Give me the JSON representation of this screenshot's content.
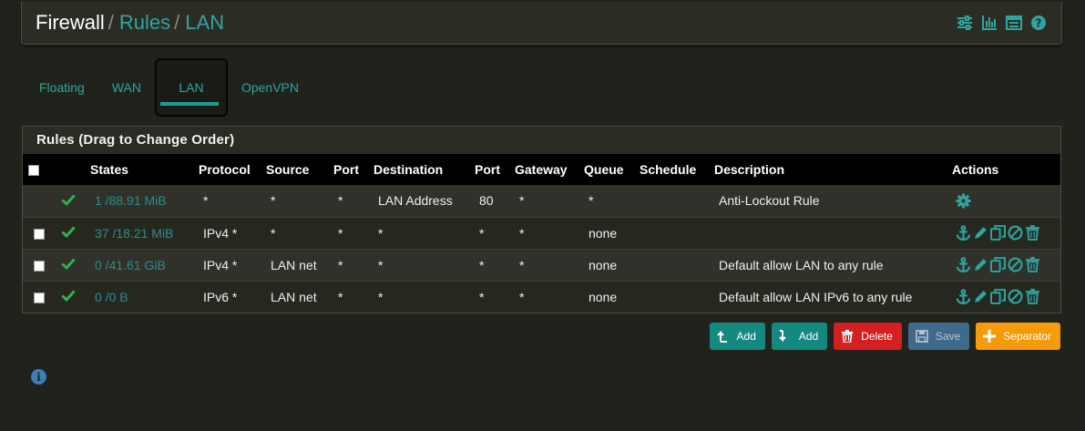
{
  "breadcrumb": {
    "root": "Firewall",
    "sep1": "/",
    "level2": "Rules",
    "sep2": "/",
    "level3": "LAN"
  },
  "header_icons": [
    "sliders-icon",
    "bar-chart-icon",
    "list-icon",
    "help-icon"
  ],
  "tabs": [
    {
      "label": "Floating",
      "active": false
    },
    {
      "label": "WAN",
      "active": false
    },
    {
      "label": "LAN",
      "active": true
    },
    {
      "label": "OpenVPN",
      "active": false
    }
  ],
  "panel": {
    "title": "Rules (Drag to Change Order)",
    "columns": [
      "",
      "",
      "States",
      "Protocol",
      "Source",
      "Port",
      "Destination",
      "Port",
      "Gateway",
      "Queue",
      "Schedule",
      "Description",
      "Actions"
    ],
    "rows": [
      {
        "checkbox": false,
        "states": "1 /88.91 MiB",
        "protocol": "*",
        "source": "*",
        "port": "*",
        "destination": "LAN Address",
        "dport": "80",
        "gateway": "*",
        "queue": "*",
        "schedule": "",
        "description": "Anti-Lockout Rule",
        "actions": [
          "gear-icon"
        ]
      },
      {
        "checkbox": true,
        "states": "37 /18.21 MiB",
        "protocol": "IPv4 *",
        "source": "*",
        "port": "*",
        "destination": "*",
        "dport": "*",
        "gateway": "*",
        "queue": "none",
        "schedule": "",
        "description": "",
        "actions": [
          "anchor-icon",
          "pencil-icon",
          "copy-icon",
          "ban-icon",
          "trash-icon"
        ]
      },
      {
        "checkbox": true,
        "states": "0 /41.61 GiB",
        "protocol": "IPv4 *",
        "source": "LAN net",
        "port": "*",
        "destination": "*",
        "dport": "*",
        "gateway": "*",
        "queue": "none",
        "schedule": "",
        "description": "Default allow LAN to any rule",
        "actions": [
          "anchor-icon",
          "pencil-icon",
          "copy-icon",
          "ban-icon",
          "trash-icon"
        ]
      },
      {
        "checkbox": true,
        "states": "0 /0 B",
        "protocol": "IPv6 *",
        "source": "LAN net",
        "port": "*",
        "destination": "*",
        "dport": "*",
        "gateway": "*",
        "queue": "none",
        "schedule": "",
        "description": "Default allow LAN IPv6 to any rule",
        "actions": [
          "anchor-icon",
          "pencil-icon",
          "copy-icon",
          "ban-icon",
          "trash-icon"
        ]
      }
    ]
  },
  "buttons": {
    "add_top": "Add",
    "add_bottom": "Add",
    "delete": "Delete",
    "save": "Save",
    "separator": "Separator"
  },
  "colors": {
    "accent": "#1f9c92",
    "link": "#2fa5a0",
    "pass": "#2fb34a",
    "delete": "#d42020",
    "save": "#3f6a8a",
    "separator": "#f59a0b"
  }
}
